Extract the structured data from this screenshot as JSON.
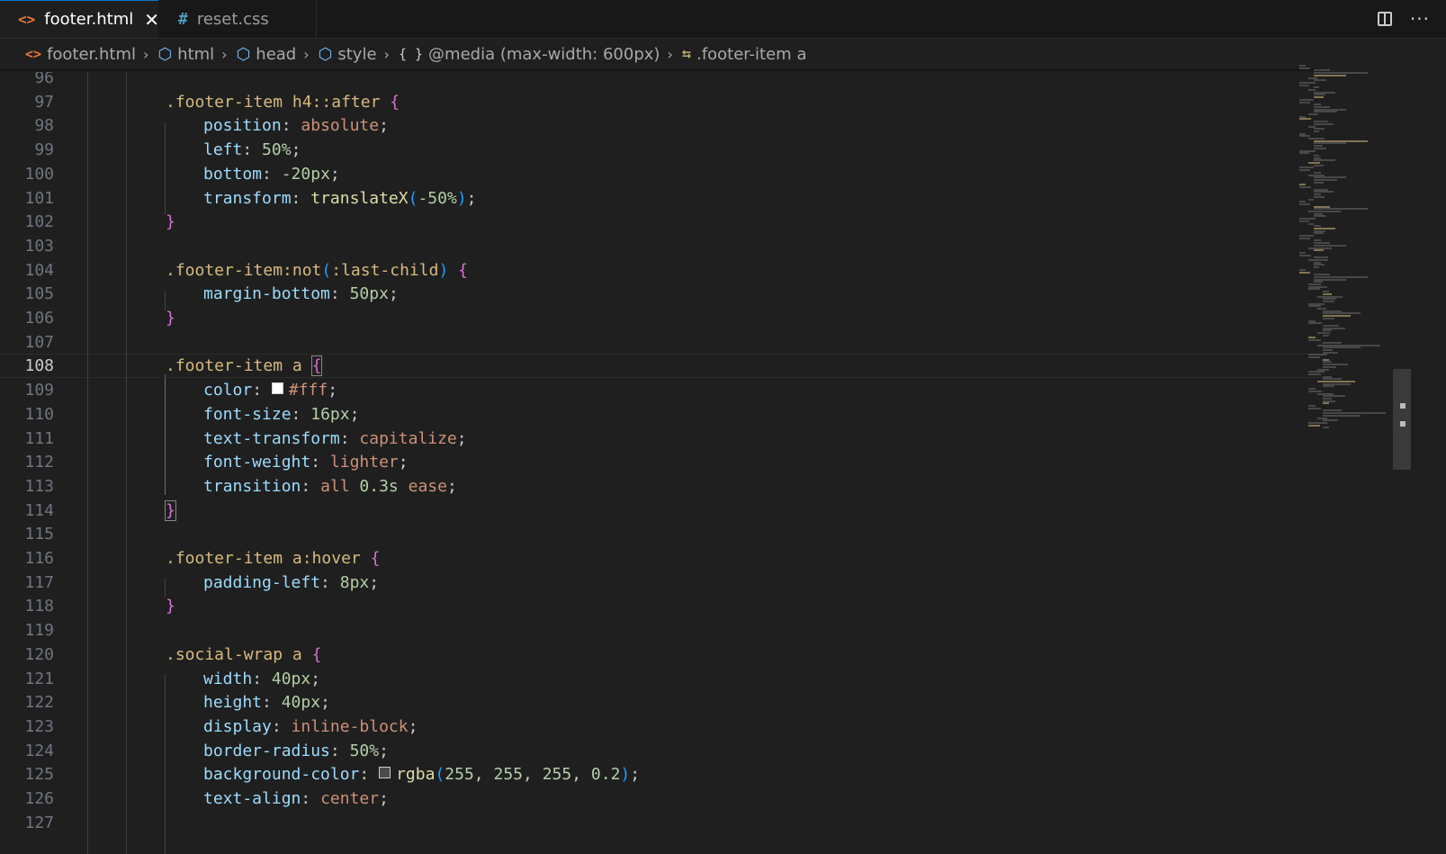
{
  "tabs": [
    {
      "label": "footer.html",
      "icon": "html-code-icon",
      "active": true
    },
    {
      "label": "reset.css",
      "icon": "hash-icon",
      "active": false
    }
  ],
  "breadcrumb": [
    {
      "label": "footer.html",
      "icon": "html-code-icon"
    },
    {
      "label": "html",
      "icon": "cube-icon"
    },
    {
      "label": "head",
      "icon": "cube-icon"
    },
    {
      "label": "style",
      "icon": "cube-icon"
    },
    {
      "label": "@media (max-width: 600px)",
      "icon": "braces-icon"
    },
    {
      "label": ".footer-item a",
      "icon": "selector-icon"
    }
  ],
  "editor": {
    "current_line": 108,
    "lines": [
      {
        "n": 96,
        "tokens": []
      },
      {
        "n": 97,
        "tokens": [
          [
            "sel",
            ".footer-item h4::after "
          ],
          [
            "b1",
            "{"
          ]
        ]
      },
      {
        "n": 98,
        "tokens": [
          [
            "prop",
            "position"
          ],
          [
            "punc",
            ": "
          ],
          [
            "val",
            "absolute"
          ],
          [
            "punc",
            ";"
          ]
        ]
      },
      {
        "n": 99,
        "tokens": [
          [
            "prop",
            "left"
          ],
          [
            "punc",
            ": "
          ],
          [
            "num",
            "50%"
          ],
          [
            "punc",
            ";"
          ]
        ]
      },
      {
        "n": 100,
        "tokens": [
          [
            "prop",
            "bottom"
          ],
          [
            "punc",
            ": "
          ],
          [
            "num",
            "-20px"
          ],
          [
            "punc",
            ";"
          ]
        ]
      },
      {
        "n": 101,
        "tokens": [
          [
            "prop",
            "transform"
          ],
          [
            "punc",
            ": "
          ],
          [
            "fn",
            "translateX"
          ],
          [
            "b2",
            "("
          ],
          [
            "num",
            "-50%"
          ],
          [
            "b2",
            ")"
          ],
          [
            "punc",
            ";"
          ]
        ]
      },
      {
        "n": 102,
        "tokens": [
          [
            "b1",
            "}"
          ]
        ]
      },
      {
        "n": 103,
        "tokens": []
      },
      {
        "n": 104,
        "tokens": [
          [
            "sel",
            ".footer-item:not"
          ],
          [
            "b2",
            "("
          ],
          [
            "sel",
            ":last-child"
          ],
          [
            "b2",
            ")"
          ],
          [
            "punc",
            " "
          ],
          [
            "b1",
            "{"
          ]
        ]
      },
      {
        "n": 105,
        "tokens": [
          [
            "prop",
            "margin-bottom"
          ],
          [
            "punc",
            ": "
          ],
          [
            "num",
            "50px"
          ],
          [
            "punc",
            ";"
          ]
        ]
      },
      {
        "n": 106,
        "tokens": [
          [
            "b1",
            "}"
          ]
        ]
      },
      {
        "n": 107,
        "tokens": []
      },
      {
        "n": 108,
        "tokens": [
          [
            "sel",
            ".footer-item a "
          ],
          [
            "b1 match",
            "{"
          ]
        ]
      },
      {
        "n": 109,
        "tokens": [
          [
            "prop",
            "color"
          ],
          [
            "punc",
            ": "
          ],
          [
            "swatch",
            "#ffffff"
          ],
          [
            "val",
            "#fff"
          ],
          [
            "punc",
            ";"
          ]
        ]
      },
      {
        "n": 110,
        "tokens": [
          [
            "prop",
            "font-size"
          ],
          [
            "punc",
            ": "
          ],
          [
            "num",
            "16px"
          ],
          [
            "punc",
            ";"
          ]
        ]
      },
      {
        "n": 111,
        "tokens": [
          [
            "prop",
            "text-transform"
          ],
          [
            "punc",
            ": "
          ],
          [
            "val",
            "capitalize"
          ],
          [
            "punc",
            ";"
          ]
        ]
      },
      {
        "n": 112,
        "tokens": [
          [
            "prop",
            "font-weight"
          ],
          [
            "punc",
            ": "
          ],
          [
            "val",
            "lighter"
          ],
          [
            "punc",
            ";"
          ]
        ]
      },
      {
        "n": 113,
        "tokens": [
          [
            "prop",
            "transition"
          ],
          [
            "punc",
            ": "
          ],
          [
            "val",
            "all "
          ],
          [
            "num",
            "0.3s"
          ],
          [
            "val",
            " ease"
          ],
          [
            "punc",
            ";"
          ]
        ]
      },
      {
        "n": 114,
        "tokens": [
          [
            "b1 match",
            "}"
          ]
        ]
      },
      {
        "n": 115,
        "tokens": []
      },
      {
        "n": 116,
        "tokens": [
          [
            "sel",
            ".footer-item a:hover "
          ],
          [
            "b1",
            "{"
          ]
        ]
      },
      {
        "n": 117,
        "tokens": [
          [
            "prop",
            "padding-left"
          ],
          [
            "punc",
            ": "
          ],
          [
            "num",
            "8px"
          ],
          [
            "punc",
            ";"
          ]
        ]
      },
      {
        "n": 118,
        "tokens": [
          [
            "b1",
            "}"
          ]
        ]
      },
      {
        "n": 119,
        "tokens": []
      },
      {
        "n": 120,
        "tokens": [
          [
            "sel",
            ".social-wrap a "
          ],
          [
            "b1",
            "{"
          ]
        ]
      },
      {
        "n": 121,
        "tokens": [
          [
            "prop",
            "width"
          ],
          [
            "punc",
            ": "
          ],
          [
            "num",
            "40px"
          ],
          [
            "punc",
            ";"
          ]
        ]
      },
      {
        "n": 122,
        "tokens": [
          [
            "prop",
            "height"
          ],
          [
            "punc",
            ": "
          ],
          [
            "num",
            "40px"
          ],
          [
            "punc",
            ";"
          ]
        ]
      },
      {
        "n": 123,
        "tokens": [
          [
            "prop",
            "display"
          ],
          [
            "punc",
            ": "
          ],
          [
            "val",
            "inline-block"
          ],
          [
            "punc",
            ";"
          ]
        ]
      },
      {
        "n": 124,
        "tokens": [
          [
            "prop",
            "border-radius"
          ],
          [
            "punc",
            ": "
          ],
          [
            "num",
            "50%"
          ],
          [
            "punc",
            ";"
          ]
        ]
      },
      {
        "n": 125,
        "tokens": [
          [
            "prop",
            "background-color"
          ],
          [
            "punc",
            ": "
          ],
          [
            "swatch",
            "rgba(255,255,255,0.2)"
          ],
          [
            "fn",
            "rgba"
          ],
          [
            "b2",
            "("
          ],
          [
            "num",
            "255"
          ],
          [
            "punc",
            ", "
          ],
          [
            "num",
            "255"
          ],
          [
            "punc",
            ", "
          ],
          [
            "num",
            "255"
          ],
          [
            "punc",
            ", "
          ],
          [
            "num",
            "0.2"
          ],
          [
            "b2",
            ")"
          ],
          [
            "punc",
            ";"
          ]
        ]
      },
      {
        "n": 126,
        "tokens": [
          [
            "prop",
            "text-align"
          ],
          [
            "punc",
            ": "
          ],
          [
            "val",
            "center"
          ],
          [
            "punc",
            ";"
          ]
        ]
      },
      {
        "n": 127,
        "tokens": []
      }
    ]
  },
  "colors": {
    "editor_bg": "#1f1f1f",
    "selector": "#d7ba7d",
    "property": "#9cdcfe",
    "value": "#ce9178",
    "number": "#b5cea8",
    "function": "#dcdcaa",
    "bracket_level1": "#da70d6",
    "bracket_level2": "#179fff"
  }
}
